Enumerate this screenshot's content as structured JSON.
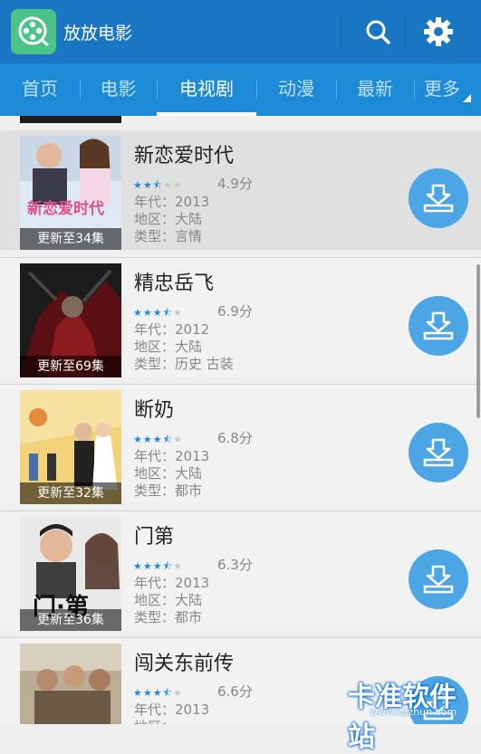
{
  "app": {
    "title": "放放电影",
    "logo_icon": "film-reel-icon",
    "search_icon": "search-icon",
    "settings_icon": "gear-icon"
  },
  "tabs": [
    {
      "label": "首页"
    },
    {
      "label": "电影"
    },
    {
      "label": "电视剧",
      "active": true
    },
    {
      "label": "动漫"
    },
    {
      "label": "最新"
    },
    {
      "label": "更多"
    }
  ],
  "colors": {
    "appbar": "#1a75c2",
    "tabbar": "#1d8ad8",
    "download": "#4ca6e6",
    "star_on": "#1d8ad8"
  },
  "items": [
    {
      "title": "新恋爱时代",
      "badge": "更新至34集",
      "stars": 2.5,
      "score": "4.9分",
      "year": "年代：2013",
      "region": "地区：大陆",
      "genre": "类型：言情"
    },
    {
      "title": "精忠岳飞",
      "badge": "更新至69集",
      "stars": 3.5,
      "score": "6.9分",
      "year": "年代：2012",
      "region": "地区：大陆",
      "genre": "类型：历史 古装"
    },
    {
      "title": "断奶",
      "badge": "更新至32集",
      "stars": 3.5,
      "score": "6.8分",
      "year": "年代：2013",
      "region": "地区：大陆",
      "genre": "类型：都市"
    },
    {
      "title": "门第",
      "badge": "更新至36集",
      "stars": 3.5,
      "score": "6.3分",
      "year": "年代：2013",
      "region": "地区：大陆",
      "genre": "类型：都市"
    },
    {
      "title": "闯关东前传",
      "badge": "",
      "stars": 3.5,
      "score": "6.6分",
      "year": "年代：2013",
      "region": "地区：",
      "genre": ""
    }
  ],
  "watermark": {
    "text": "卡准软件站",
    "url": "www.kazhun.com"
  }
}
